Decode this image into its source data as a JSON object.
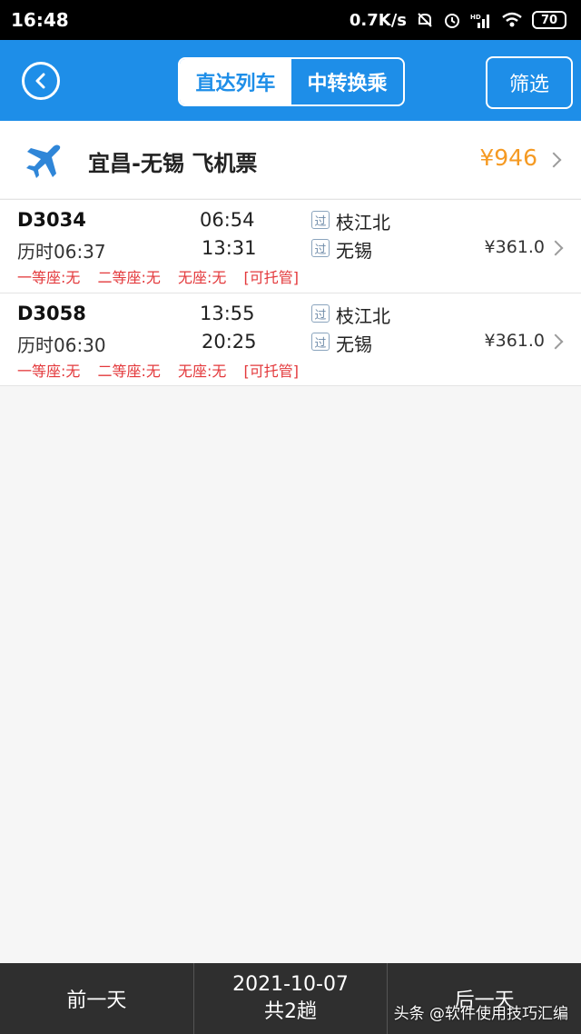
{
  "status_bar": {
    "time": "16:48",
    "network_speed": "0.7K/s",
    "battery": "70",
    "icons": [
      "mute-alarm-icon",
      "alarm-clock-icon",
      "hd-signal-icon",
      "wifi-icon",
      "battery-icon"
    ]
  },
  "header": {
    "tabs": [
      {
        "label": "直达列车",
        "active": true
      },
      {
        "label": "中转换乘",
        "active": false
      }
    ],
    "filter_label": "筛选",
    "accent_color": "#1e8ee8"
  },
  "flight": {
    "label": "宜昌-无锡 飞机票",
    "price": "¥946",
    "price_color": "#f59a23"
  },
  "trains": [
    {
      "number": "D3034",
      "duration": "历时06:37",
      "depart_time": "06:54",
      "arrive_time": "13:31",
      "badge": "过",
      "from_station": "枝江北",
      "to_station": "无锡",
      "price": "¥361.0",
      "seats": [
        "一等座:无",
        "二等座:无",
        "无座:无",
        "[可托管]"
      ]
    },
    {
      "number": "D3058",
      "duration": "历时06:30",
      "depart_time": "13:55",
      "arrive_time": "20:25",
      "badge": "过",
      "from_station": "枝江北",
      "to_station": "无锡",
      "price": "¥361.0",
      "seats": [
        "一等座:无",
        "二等座:无",
        "无座:无",
        "[可托管]"
      ]
    }
  ],
  "bottom_bar": {
    "prev_day": "前一天",
    "date": "2021-10-07",
    "count": "共2趟",
    "next_day": "后一天"
  },
  "watermark": "头条 @软件使用技巧汇编"
}
